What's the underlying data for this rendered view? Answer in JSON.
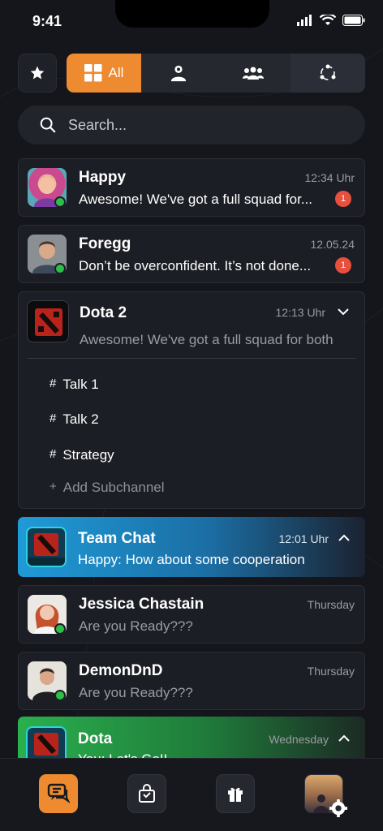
{
  "status": {
    "time": "9:41"
  },
  "filters": {
    "tabs": [
      {
        "label": "All",
        "icon": "grid-icon",
        "active": true
      },
      {
        "label": "",
        "icon": "person-icon"
      },
      {
        "label": "",
        "icon": "group-icon"
      },
      {
        "label": "",
        "icon": "community-icon"
      }
    ]
  },
  "search": {
    "placeholder": "Search..."
  },
  "chats": [
    {
      "name": "Happy",
      "time": "12:34 Uhr",
      "message": "Awesome! We've got a full squad for...",
      "unread": "1"
    },
    {
      "name": "Foregg",
      "time": "12.05.24",
      "message": "Don’t be overconfident. It’s not done...",
      "unread": "1"
    }
  ],
  "group": {
    "name": "Dota 2",
    "time": "12:13 Uhr",
    "message": "Awesome! We've got a full squad for both",
    "subchannels": [
      {
        "hash": "#",
        "label": "Talk 1"
      },
      {
        "hash": "#",
        "label": "Talk 2"
      },
      {
        "hash": "#",
        "label": "Strategy"
      }
    ],
    "add_label": "Add Subchannel",
    "add_prefix": "+"
  },
  "team_chat": {
    "name": "Team Chat",
    "time": "12:01 Uhr",
    "message": "Happy: How about some cooperation"
  },
  "contacts": [
    {
      "name": "Jessica Chastain",
      "time": "Thursday",
      "message": "Are you Ready???"
    },
    {
      "name": "DemonDnD",
      "time": "Thursday",
      "message": "Are you Ready???"
    }
  ],
  "dota": {
    "name": "Dota",
    "time": "Wednesday",
    "message": "You: Let's Go!!"
  },
  "colors": {
    "accent": "#ee8a2f",
    "online": "#2dbf4a",
    "unread": "#e8503d",
    "team_gradient": "#1f9bd8",
    "dota_gradient": "#2ab04d"
  }
}
